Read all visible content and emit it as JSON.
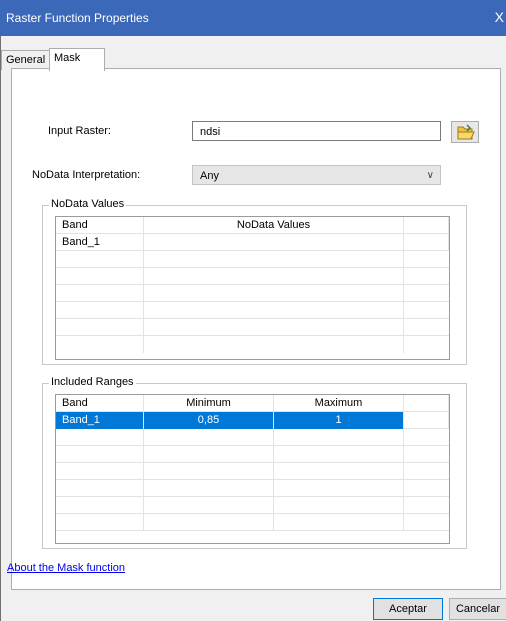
{
  "window": {
    "title": "Raster Function Properties",
    "close": "X"
  },
  "tabs": [
    {
      "label": "General"
    },
    {
      "label": "Mask"
    }
  ],
  "form": {
    "input_raster_label": "Input Raster:",
    "input_raster_value": "ndsi",
    "nodata_interp_label": "NoData Interpretation:",
    "nodata_interp_value": "Any"
  },
  "nodata_group": {
    "title": "NoData Values",
    "headers": [
      "Band",
      "NoData Values"
    ],
    "rows": [
      [
        "Band_1",
        ""
      ]
    ]
  },
  "ranges_group": {
    "title": "Included Ranges",
    "headers": [
      "Band",
      "Minimum",
      "Maximum"
    ],
    "rows": [
      [
        "Band_1",
        "0,85",
        "1"
      ]
    ]
  },
  "about_link": "About the Mask function",
  "buttons": {
    "accept": "Aceptar",
    "cancel": "Cancelar"
  },
  "colors": {
    "titlebar": "#3b68b8",
    "selection": "#0078d7",
    "link": "#0000ee"
  }
}
